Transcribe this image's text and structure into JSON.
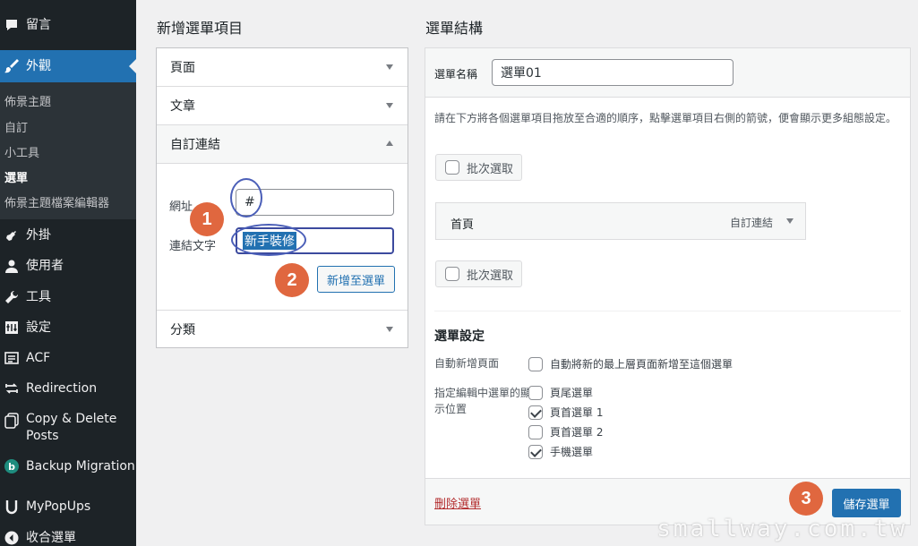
{
  "sidebar": {
    "items": [
      {
        "label": "留言",
        "icon": "comment-icon"
      },
      {
        "label": "外觀",
        "icon": "paintbrush-icon"
      },
      {
        "label": "外掛",
        "icon": "plugin-icon"
      },
      {
        "label": "使用者",
        "icon": "user-icon"
      },
      {
        "label": "工具",
        "icon": "wrench-icon"
      },
      {
        "label": "設定",
        "icon": "settings-icon"
      },
      {
        "label": "ACF",
        "icon": "acf-icon"
      },
      {
        "label": "Redirection",
        "icon": "redirect-icon"
      },
      {
        "label": "Copy & Delete Posts",
        "icon": "copy-icon"
      },
      {
        "label": "Backup Migration",
        "icon": "backup-icon"
      },
      {
        "label": "MyPopUps",
        "icon": "popup-icon"
      },
      {
        "label": "收合選單",
        "icon": "collapse-icon"
      }
    ],
    "submenu": [
      "佈景主題",
      "自訂",
      "小工具",
      "選單",
      "佈景主題檔案編輯器"
    ],
    "current_sub": "選單"
  },
  "add_items": {
    "title": "新增選單項目",
    "sections": [
      "頁面",
      "文章",
      "自訂連結",
      "分類"
    ],
    "url_label": "網址",
    "url_value": "#",
    "link_text_label": "連結文字",
    "link_text_value": "新手裝修",
    "add_button": "新增至選單"
  },
  "structure": {
    "title": "選單結構",
    "menu_name_label": "選單名稱",
    "menu_name_value": "選單01",
    "instructions": "請在下方將各個選單項目拖放至合適的順序，點擊選單項目右側的箭號，便會顯示更多組態設定。",
    "bulk_select": "批次選取",
    "menu_item": {
      "title": "首頁",
      "type": "自訂連結"
    },
    "settings_title": "選單設定",
    "auto_add_label": "自動新增頁面",
    "auto_add_option": "自動將新的最上層頁面新增至這個選單",
    "location_label": "指定編輯中選單的顯示位置",
    "locations": [
      {
        "label": "頁尾選單",
        "checked": false
      },
      {
        "label": "頁首選單 1",
        "checked": true
      },
      {
        "label": "頁首選單 2",
        "checked": false
      },
      {
        "label": "手機選單",
        "checked": true
      }
    ],
    "delete_link": "刪除選單",
    "save_button": "儲存選單"
  },
  "annotations": [
    "1",
    "2",
    "3"
  ],
  "watermark": "smallway.com.tw"
}
